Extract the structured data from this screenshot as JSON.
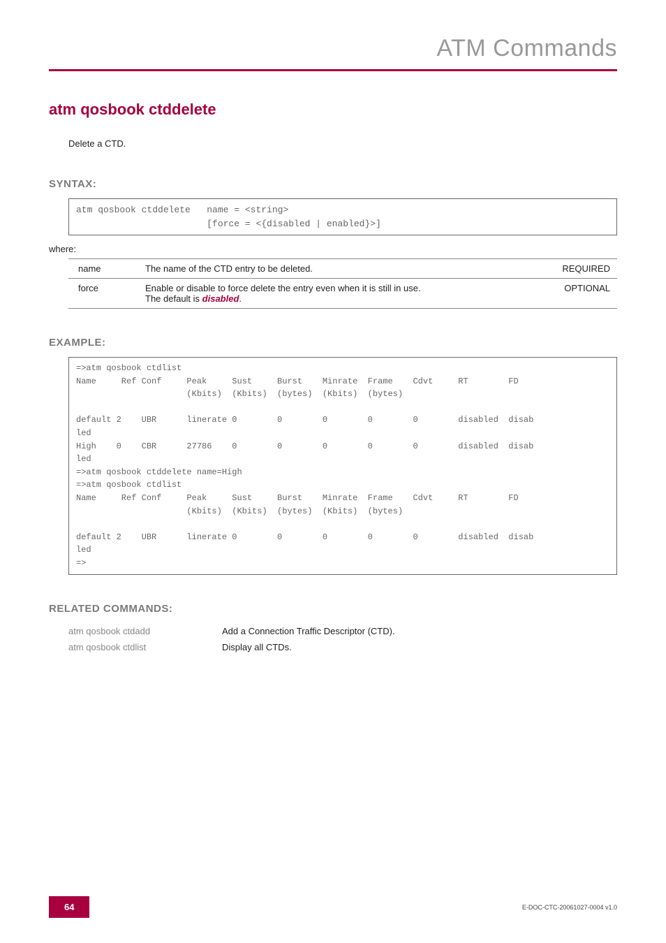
{
  "header": {
    "title": "ATM Commands"
  },
  "command": {
    "title": "atm qosbook ctddelete",
    "description": "Delete a CTD."
  },
  "syntax": {
    "heading": "SYNTAX:",
    "code": "atm qosbook ctddelete   name = <string>\n                        [force = <{disabled | enabled}>]",
    "where_label": "where:",
    "params": [
      {
        "name": "name",
        "desc": "The name of the CTD entry to be deleted.",
        "req": "REQUIRED"
      },
      {
        "name": "force",
        "desc_pre": "Enable or disable to force delete the entry even when it is still in use.\nThe default is ",
        "desc_em": "disabled",
        "desc_post": ".",
        "req": "OPTIONAL"
      }
    ]
  },
  "example": {
    "heading": "EXAMPLE:",
    "code": "=>atm qosbook ctdlist\nName     Ref Conf     Peak     Sust     Burst    Minrate  Frame    Cdvt     RT        FD\n                      (Kbits)  (Kbits)  (bytes)  (Kbits)  (bytes)\n\ndefault 2    UBR      linerate 0        0        0        0        0        disabled  disab\nled\nHigh    0    CBR      27786    0        0        0        0        0        disabled  disab\nled\n=>atm qosbook ctddelete name=High\n=>atm qosbook ctdlist\nName     Ref Conf     Peak     Sust     Burst    Minrate  Frame    Cdvt     RT        FD\n                      (Kbits)  (Kbits)  (bytes)  (Kbits)  (bytes)\n\ndefault 2    UBR      linerate 0        0        0        0        0        disabled  disab\nled\n=>"
  },
  "related": {
    "heading": "RELATED COMMANDS:",
    "rows": [
      {
        "cmd": "atm qosbook ctdadd",
        "desc": "Add a Connection Traffic Descriptor (CTD)."
      },
      {
        "cmd": "atm qosbook ctdlist",
        "desc": "Display all CTDs."
      }
    ]
  },
  "footer": {
    "page": "64",
    "docid": "E-DOC-CTC-20061027-0004 v1.0"
  }
}
